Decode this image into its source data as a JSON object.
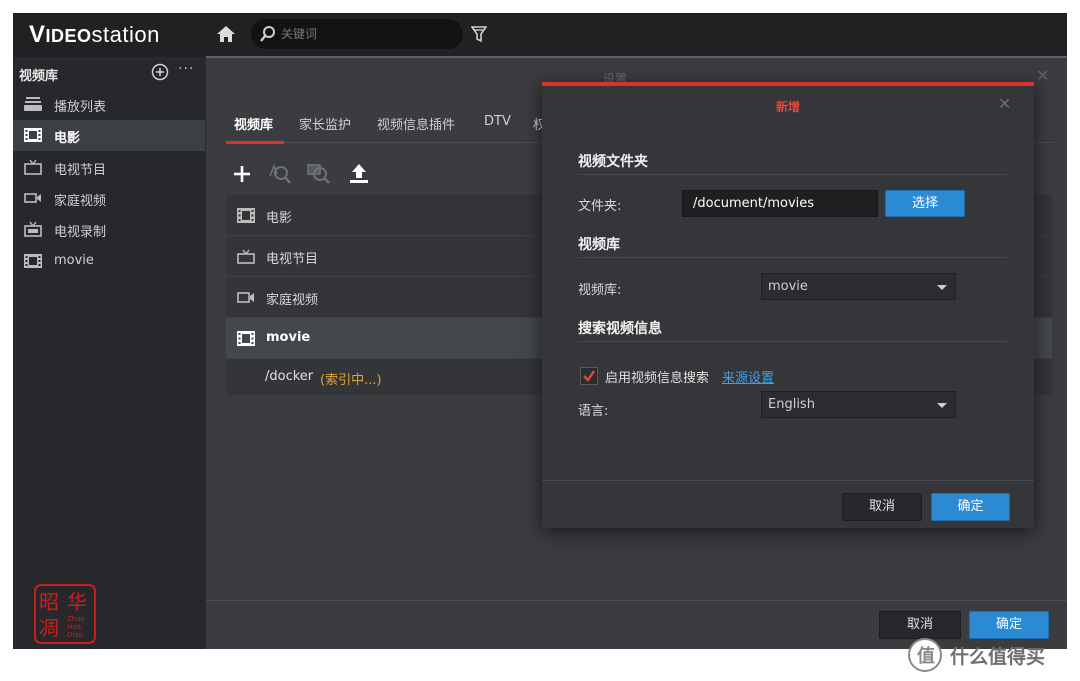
{
  "app": {
    "logo": "VIDEOstation"
  },
  "search": {
    "placeholder": "关键词"
  },
  "sidebar": {
    "header": "视频库",
    "more": "···",
    "items": [
      {
        "label": "播放列表",
        "icon": "playlist-icon"
      },
      {
        "label": "电影",
        "icon": "movie-film-icon",
        "active": true
      },
      {
        "label": "电视节目",
        "icon": "tv-icon"
      },
      {
        "label": "家庭视频",
        "icon": "camcorder-icon"
      },
      {
        "label": "电视录制",
        "icon": "tv-record-icon"
      },
      {
        "label": "movie",
        "icon": "movie-film-icon"
      }
    ]
  },
  "settings": {
    "title": "设置",
    "close": "✕",
    "tabs": [
      "视频库",
      "家长监护",
      "视频信息插件",
      "DTV",
      "权"
    ],
    "library_list": [
      {
        "label": "电影",
        "icon": "movie-film-icon"
      },
      {
        "label": "电视节目",
        "icon": "tv-icon"
      },
      {
        "label": "家庭视频",
        "icon": "camcorder-icon"
      },
      {
        "label": "movie",
        "icon": "movie-film-icon",
        "selected": true
      }
    ],
    "folder_row": {
      "path": "/docker",
      "status": "(索引中...)"
    },
    "buttons": {
      "cancel": "取消",
      "ok": "确定"
    }
  },
  "dialog": {
    "title": "新增",
    "close": "✕",
    "section_folder": "视频文件夹",
    "folder_label": "文件夹:",
    "folder_value": "/document/movies",
    "select_button": "选择",
    "section_library": "视频库",
    "library_label": "视频库:",
    "library_value": "movie",
    "section_search": "搜索视频信息",
    "enable_search_label": "启用视频信息搜索",
    "enable_search_checked": true,
    "source_settings_link": "来源设置",
    "language_label": "语言:",
    "language_value": "English",
    "buttons": {
      "cancel": "取消",
      "ok": "确定"
    }
  },
  "watermark": {
    "text": "什么值得买",
    "stamp_text": "Zhao Hua Diao"
  },
  "colors": {
    "accent_red": "#d9342b",
    "accent_blue": "#2a8ad4",
    "warning": "#e0a530",
    "link": "#3ea0e8"
  }
}
